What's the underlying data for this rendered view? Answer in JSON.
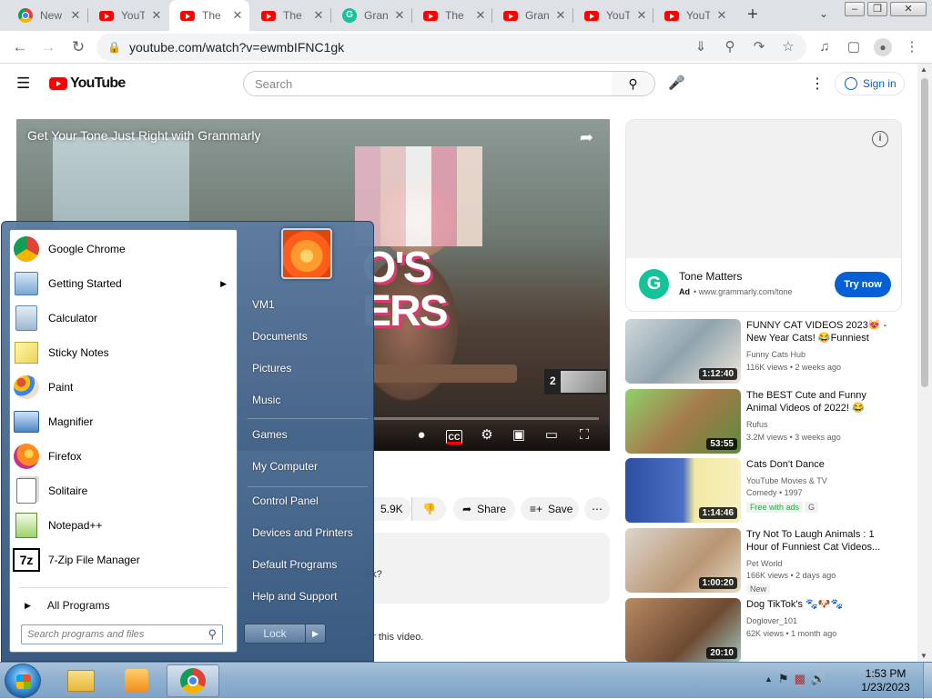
{
  "browser": {
    "tabs": [
      {
        "title": "New",
        "icon": "chrome-icon"
      },
      {
        "title": "YouT",
        "icon": "youtube-icon"
      },
      {
        "title": "The",
        "icon": "youtube-icon",
        "active": true
      },
      {
        "title": "The",
        "icon": "youtube-icon"
      },
      {
        "title": "Gran",
        "icon": "grammarly-icon"
      },
      {
        "title": "The",
        "icon": "youtube-icon"
      },
      {
        "title": "Gran",
        "icon": "youtube-icon"
      },
      {
        "title": "YouT",
        "icon": "youtube-icon"
      },
      {
        "title": "YouT",
        "icon": "youtube-icon"
      }
    ],
    "new_tab_symbol": "+",
    "url": "youtube.com/watch?v=ewmbIFNC1gk"
  },
  "youtube": {
    "logo_text": "YouTube",
    "search_placeholder": "Search",
    "signin_label": "Sign in",
    "video_overlay_title": "Get Your Tone Just Right with Grammarly",
    "video_logo_text": "O'S\nERS",
    "endcard_count": "2",
    "actions": {
      "likes": "5.9K",
      "share": "Share",
      "save": "Save"
    },
    "description_fragment": "nk?",
    "comments_fragment": "or this video.",
    "ad": {
      "name": "Tone Matters",
      "ad_label": "Ad",
      "domain": "www.grammarly.com/tone",
      "button": "Try now"
    },
    "recommendations": [
      {
        "title": "FUNNY CAT VIDEOS 2023😻 - New Year Cats! 😂Funniest Cat...",
        "channel": "Funny Cats Hub",
        "meta": "116K views • 2 weeks ago",
        "duration": "1:12:40",
        "badge": ""
      },
      {
        "title": "The BEST Cute and Funny Animal Videos of 2022! 😂",
        "channel": "Rufus",
        "meta": "3.2M views • 3 weeks ago",
        "duration": "53:55",
        "badge": ""
      },
      {
        "title": "Cats Don't Dance",
        "channel": "YouTube Movies & TV",
        "meta": "Comedy • 1997",
        "duration": "1:14:46",
        "badge": "Free with ads",
        "badge2": "G"
      },
      {
        "title": "Try Not To Laugh Animals : 1 Hour of Funniest Cat Videos...",
        "channel": "Pet World",
        "meta": "166K views • 2 days ago",
        "duration": "1:00:20",
        "badge": "New"
      },
      {
        "title": "Dog TikTok's 🐾🐶🐾",
        "channel": "Doglover_101",
        "meta": "62K views • 1 month ago",
        "duration": "20:10",
        "badge": ""
      }
    ]
  },
  "start_menu": {
    "programs": [
      {
        "label": "Google Chrome",
        "icon": "chrome-icon"
      },
      {
        "label": "Getting Started",
        "icon": "getting-started-icon",
        "submenu": true
      },
      {
        "label": "Calculator",
        "icon": "calculator-icon"
      },
      {
        "label": "Sticky Notes",
        "icon": "sticky-notes-icon"
      },
      {
        "label": "Paint",
        "icon": "paint-icon"
      },
      {
        "label": "Magnifier",
        "icon": "magnifier-icon"
      },
      {
        "label": "Firefox",
        "icon": "firefox-icon"
      },
      {
        "label": "Solitaire",
        "icon": "solitaire-icon"
      },
      {
        "label": "Notepad++",
        "icon": "notepadpp-icon"
      },
      {
        "label": "7-Zip File Manager",
        "icon": "7zip-icon"
      }
    ],
    "all_programs": "All Programs",
    "search_placeholder": "Search programs and files",
    "right_links": [
      "VM1",
      "Documents",
      "Pictures",
      "Music",
      "Games",
      "My Computer",
      "Control Panel",
      "Devices and Printers",
      "Default Programs",
      "Help and Support"
    ],
    "lock_label": "Lock"
  },
  "taskbar": {
    "time": "1:53 PM",
    "date": "1/23/2023"
  }
}
